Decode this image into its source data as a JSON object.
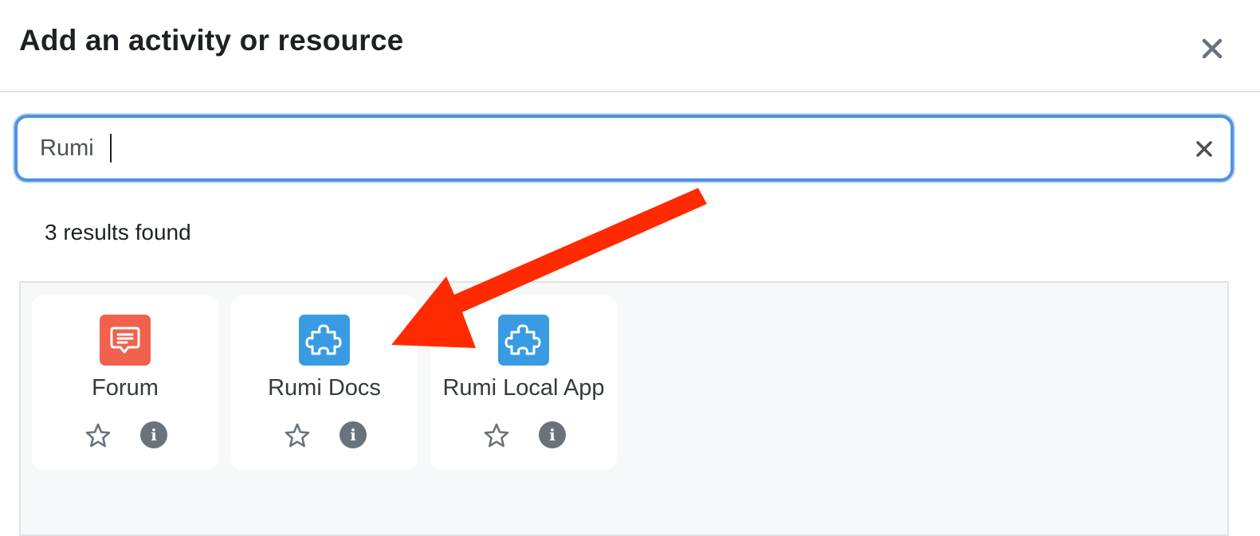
{
  "modal": {
    "title": "Add an activity or resource",
    "close_icon": "close-icon"
  },
  "search": {
    "value": "Rumi",
    "clear_icon": "clear-search-icon"
  },
  "results": {
    "count_text": "3 results found",
    "items": [
      {
        "label": "Forum",
        "icon": "forum-icon",
        "icon_color": "#f0624d",
        "star_icon": "star-outline-icon",
        "info_icon": "info-icon"
      },
      {
        "label": "Rumi Docs",
        "icon": "puzzle-piece-icon",
        "icon_color": "#399be2",
        "star_icon": "star-outline-icon",
        "info_icon": "info-icon"
      },
      {
        "label": "Rumi Local App",
        "icon": "puzzle-piece-icon",
        "icon_color": "#399be2",
        "star_icon": "star-outline-icon",
        "info_icon": "info-icon"
      }
    ]
  },
  "annotation": {
    "arrow_color": "#ff2a00",
    "arrow_icon": "annotation-arrow"
  }
}
